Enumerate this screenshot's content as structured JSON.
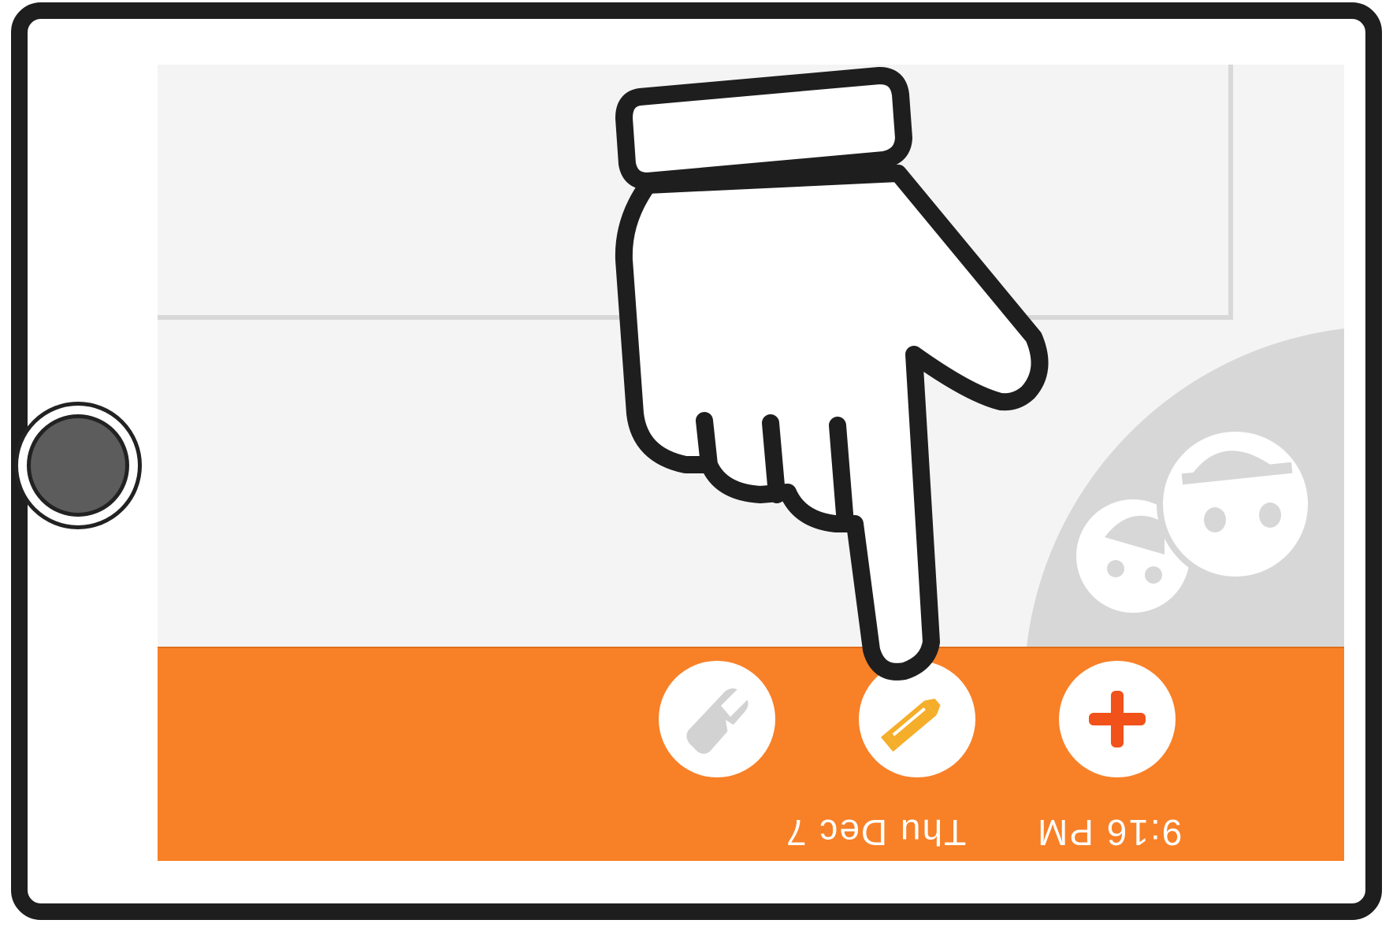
{
  "status_bar": {
    "time": "9:16 PM",
    "date": "Thu Dec 7"
  },
  "toolbar": {
    "buttons": [
      {
        "name": "eraser",
        "icon": "eraser-icon"
      },
      {
        "name": "pencil",
        "icon": "pencil-icon"
      },
      {
        "name": "add",
        "icon": "plus-icon"
      }
    ]
  },
  "icons": {
    "home": "home-button",
    "avatars": "people-icon",
    "hand": "pointing-hand-icon"
  },
  "colors": {
    "toolbar": "#f88027",
    "plus": "#f0521a",
    "pencil": "#f5ae2a",
    "screen_bg": "#f4f4f4",
    "deco": "#d7d7d7"
  }
}
